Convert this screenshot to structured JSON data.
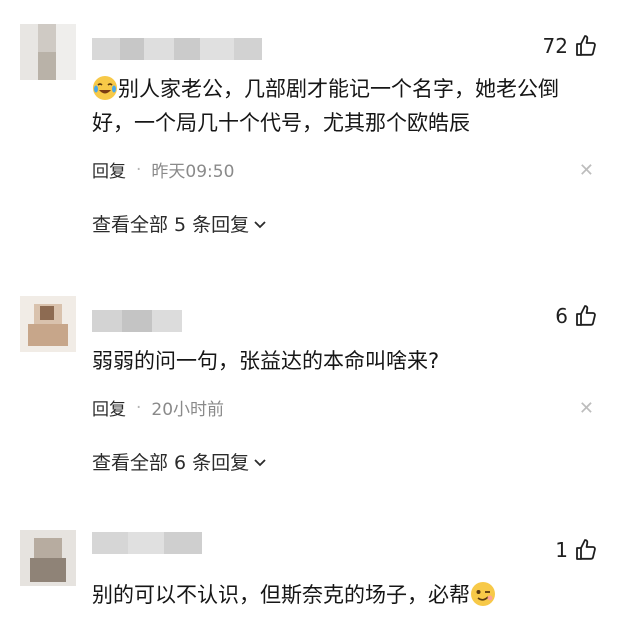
{
  "comments": [
    {
      "likes": "72",
      "text_line1": "别人家老公，几部剧才能记一个名字，她老公倒",
      "text_line2": "好，一个局几十个代号，尤其那个欧皓辰",
      "reply_label": "回复",
      "time": "昨天09:50",
      "view_all": "查看全部 5 条回复",
      "emoji": "crying-laughing-emoji"
    },
    {
      "likes": "6",
      "text_line1": "弱弱的问一句，张益达的本命叫啥来?",
      "reply_label": "回复",
      "time": "20小时前",
      "view_all": "查看全部 6 条回复"
    },
    {
      "likes": "1",
      "text_line1": "别的可以不认识，但斯奈克的场子，必帮",
      "emoji": "wink-emoji"
    }
  ],
  "icons": {
    "like": "thumbs-up-icon",
    "close": "close-icon",
    "chevron": "chevron-down-icon"
  },
  "colors": {
    "text": "#161616",
    "meta": "#8a8a8a",
    "emoji_yellow": "#f7c948"
  }
}
